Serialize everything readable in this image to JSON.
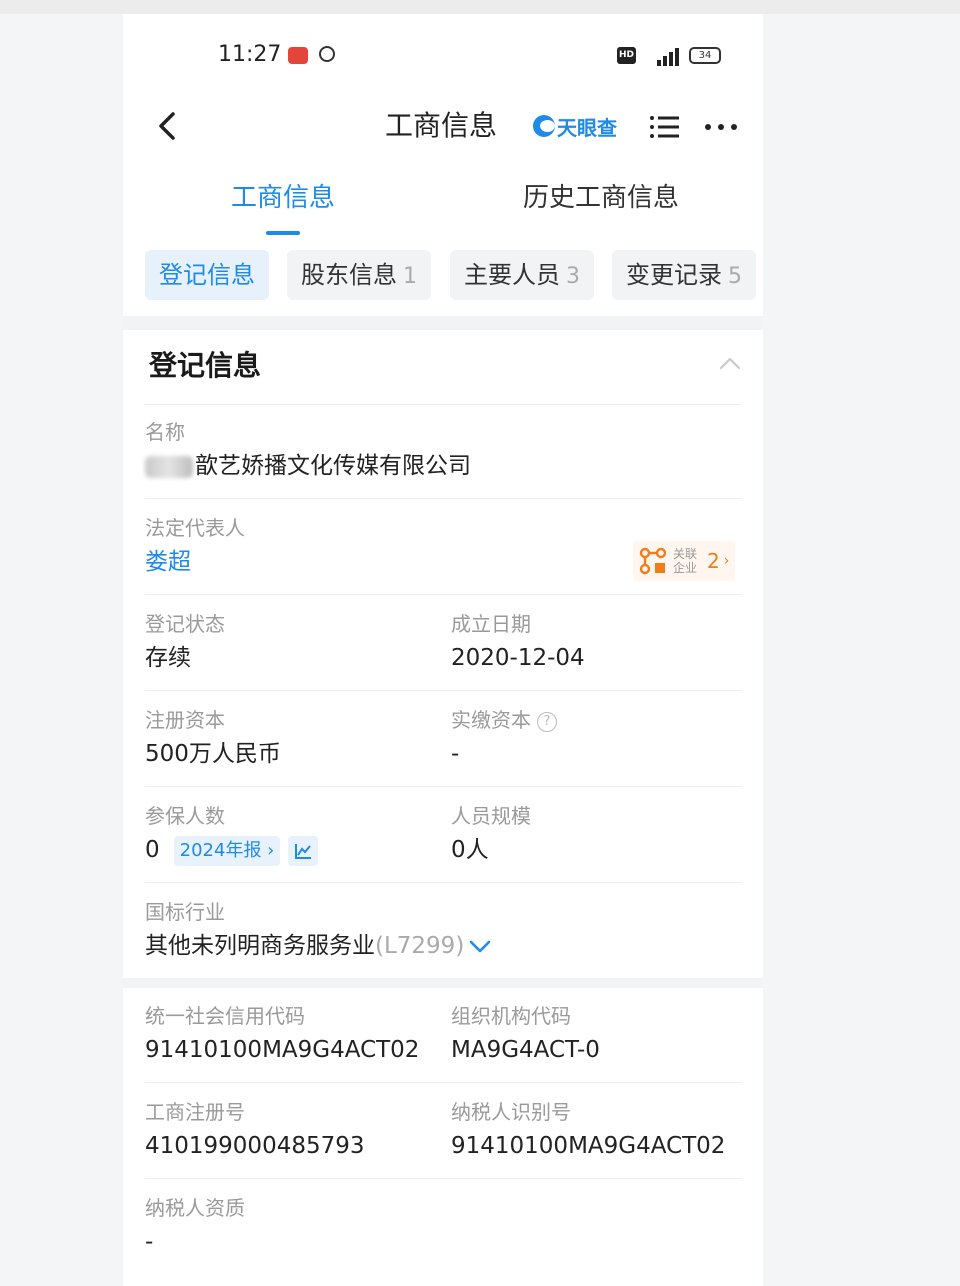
{
  "status_bar": {
    "time": "11:27",
    "hd": "HD",
    "battery": "34"
  },
  "nav": {
    "title": "工商信息",
    "brand": "天眼查"
  },
  "tabs": [
    {
      "label": "工商信息",
      "active": true
    },
    {
      "label": "历史工商信息",
      "active": false
    }
  ],
  "subtabs": [
    {
      "label": "登记信息",
      "count": ""
    },
    {
      "label": "股东信息",
      "count": "1"
    },
    {
      "label": "主要人员",
      "count": "3"
    },
    {
      "label": "变更记录",
      "count": "5"
    }
  ],
  "registration": {
    "section_title": "登记信息",
    "name_label": "名称",
    "name_value": "歆艺娇播文化传媒有限公司",
    "legal_rep_label": "法定代表人",
    "legal_rep_value": "娄超",
    "related_label": "关联企业",
    "related_count": "2",
    "status_label": "登记状态",
    "status_value": "存续",
    "founded_label": "成立日期",
    "founded_value": "2020-12-04",
    "reg_capital_label": "注册资本",
    "reg_capital_value": "500万人民币",
    "paid_capital_label": "实缴资本",
    "paid_capital_help": "?",
    "paid_capital_value": "-",
    "insured_label": "参保人数",
    "insured_value": "0",
    "insured_report": "2024年报",
    "staff_size_label": "人员规模",
    "staff_size_value": "0人",
    "industry_label": "国标行业",
    "industry_value": "其他未列明商务服务业",
    "industry_code": "(L7299)"
  },
  "codes": {
    "credit_code_label": "统一社会信用代码",
    "credit_code_value": "91410100MA9G4ACT02",
    "org_code_label": "组织机构代码",
    "org_code_value": "MA9G4ACT-0",
    "reg_no_label": "工商注册号",
    "reg_no_value": "410199000485793",
    "taxpayer_id_label": "纳税人识别号",
    "taxpayer_id_value": "91410100MA9G4ACT02",
    "taxpayer_qual_label": "纳税人资质",
    "taxpayer_qual_value": "-"
  },
  "colors": {
    "accent": "#1e8be8",
    "orange": "#f07c1a"
  }
}
